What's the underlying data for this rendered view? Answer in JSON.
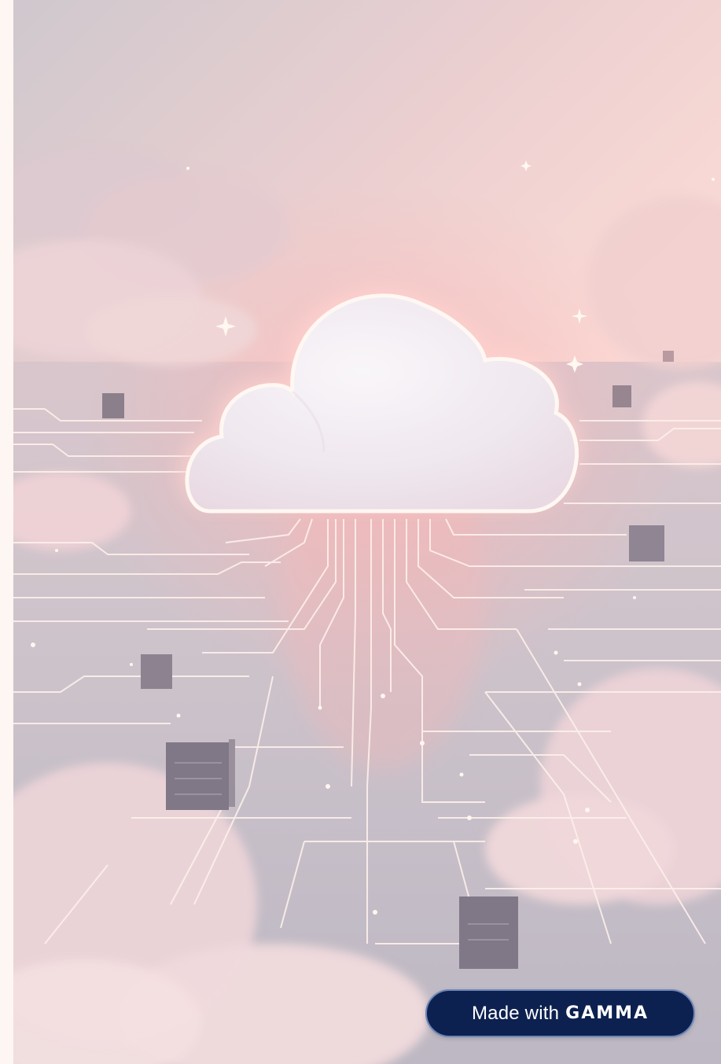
{
  "badge": {
    "made_with": "Made with",
    "brand": "GAMMA"
  },
  "colors": {
    "sky_top": "#cdc6cc",
    "sky_pink": "#f6c9c6",
    "floor": "#c7c0c9",
    "circuit_line": "#fdf0ea",
    "cloud_center": "#f3eef3",
    "badge_bg": "#0d2150",
    "badge_border": "#6d86b8",
    "page_bg": "#fdf6f2"
  },
  "icons": [
    "cloud-icon",
    "server-box-icon",
    "sparkle-icon"
  ]
}
